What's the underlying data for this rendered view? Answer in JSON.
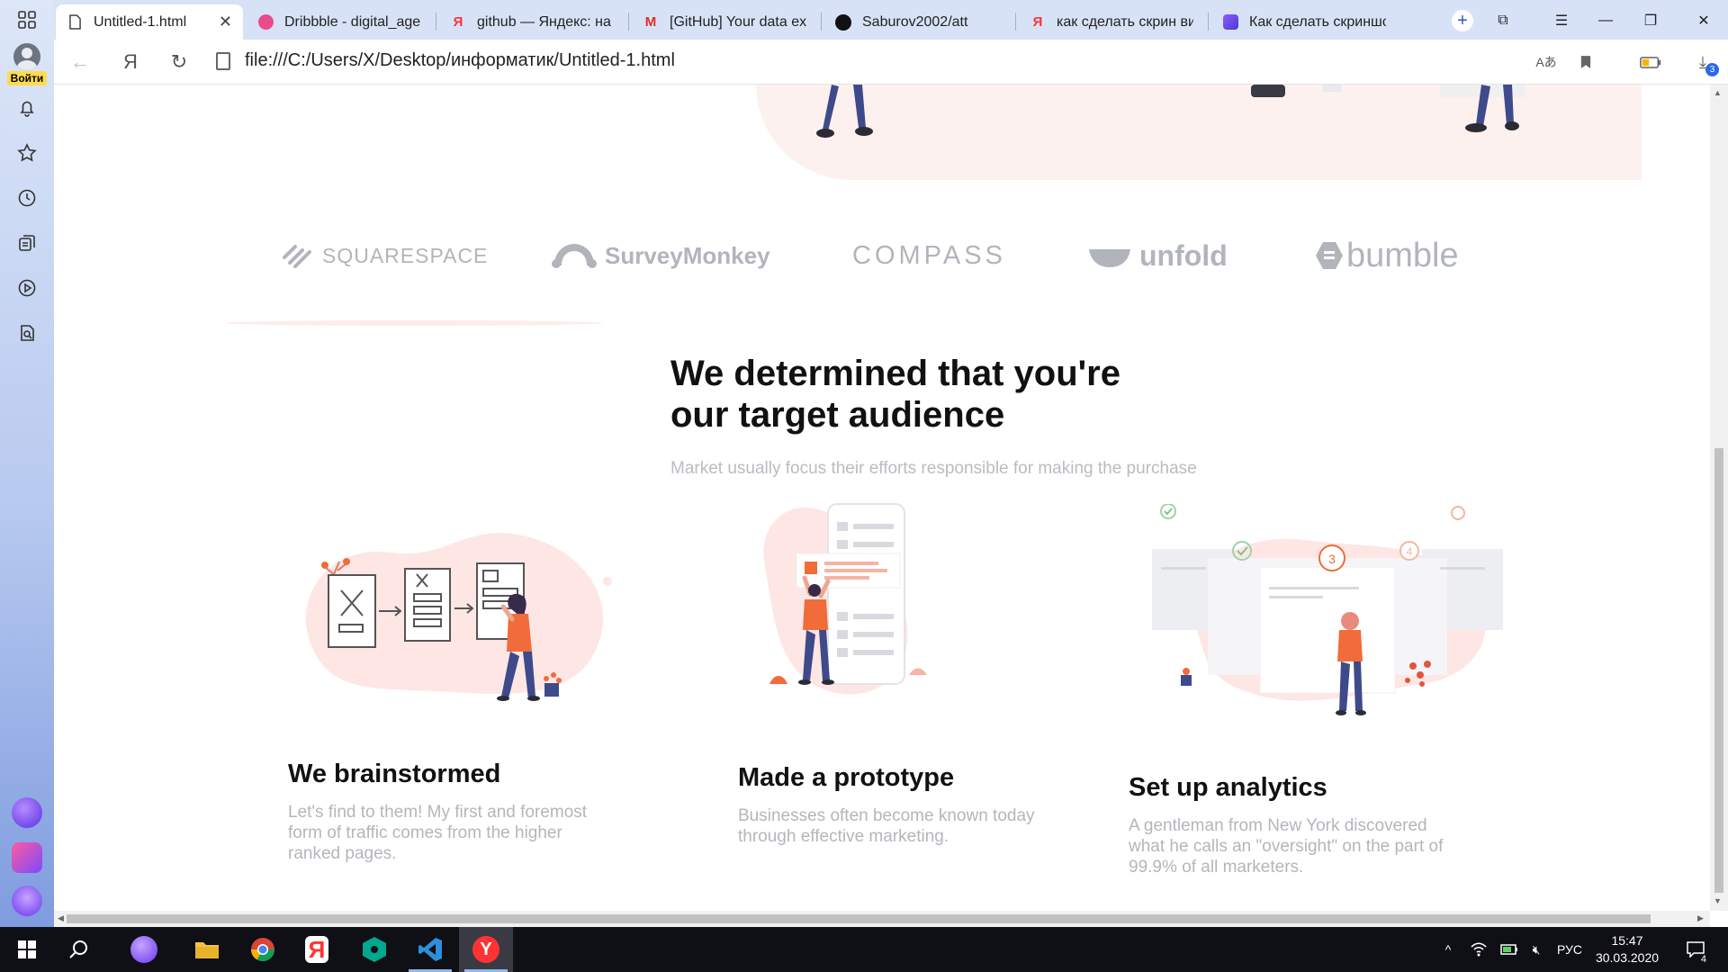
{
  "sidebar": {
    "login_label": "Войти"
  },
  "tabs": [
    {
      "title": "Untitled-1.html",
      "icon": "file-icon",
      "active": true
    },
    {
      "title": "Dribbble - digital_age",
      "icon": "dribbble-icon"
    },
    {
      "title": "github — Яндекс: на",
      "icon": "yandex-icon"
    },
    {
      "title": "[GitHub] Your data ex",
      "icon": "gmail-icon"
    },
    {
      "title": "Saburov2002/att",
      "icon": "github-icon"
    },
    {
      "title": "как сделать скрин ви",
      "icon": "yandex-icon"
    },
    {
      "title": "Как сделать скриншс",
      "icon": "site-icon"
    }
  ],
  "address_bar": {
    "url": "file:///C:/Users/X/Desktop/информатик/Untitled-1.html",
    "downloads_count": "3"
  },
  "page": {
    "logos": [
      "SQUARESPACE",
      "SurveyMonkey",
      "COMPASS",
      "unfold",
      "bumble"
    ],
    "section_title_line1": "We determined that you're",
    "section_title_line2": "our target audience",
    "section_subtitle": "Market usually focus their efforts responsible for making the purchase",
    "cards": [
      {
        "title": "We brainstormed",
        "text_lines": [
          "Let's find to them! My first and foremost",
          "form of traffic comes from the higher",
          "ranked pages."
        ]
      },
      {
        "title": "Made a prototype",
        "text_lines": [
          "Businesses often become known today",
          "through effective marketing."
        ]
      },
      {
        "title": "Set up analytics",
        "text_lines": [
          "A gentleman from New York discovered",
          "what he calls an \"oversight\" on the part of",
          "99.9% of all marketers."
        ]
      }
    ],
    "illustration_step_number": "3",
    "illustration_step_number_2": "4"
  },
  "taskbar": {
    "language": "РУС",
    "time": "15:47",
    "date": "30.03.2020",
    "notifications_count": "4"
  },
  "colors": {
    "accent_orange": "#f26b3a",
    "blob_pink": "#fde6e4",
    "logo_gray": "#b1b5bb"
  }
}
